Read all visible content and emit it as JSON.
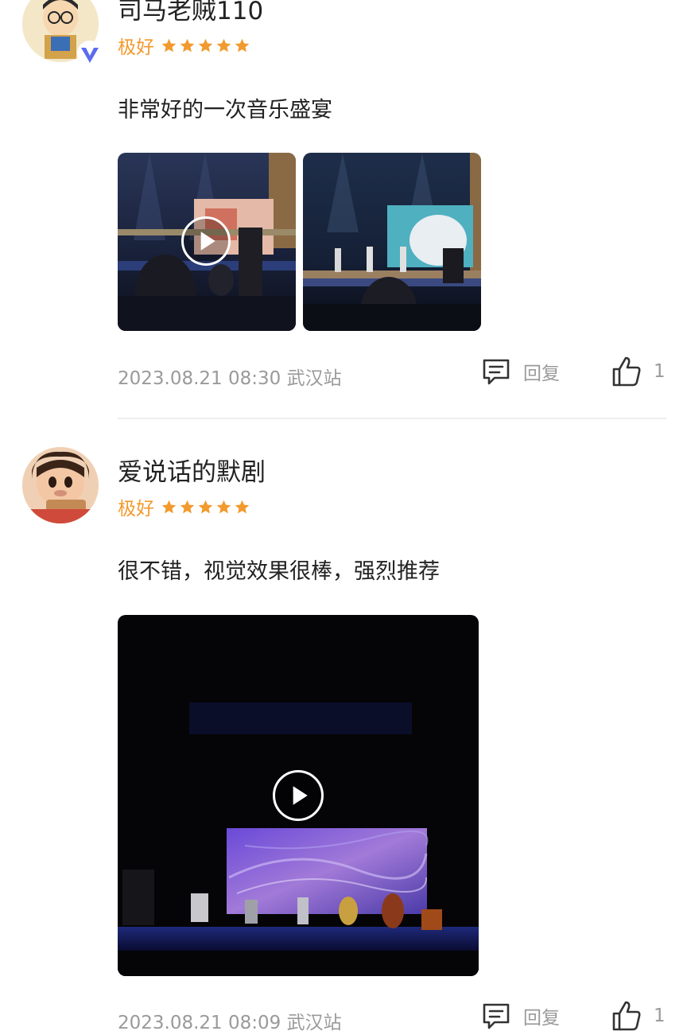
{
  "reviews": [
    {
      "username": "司马老贼110",
      "rating_text": "极好",
      "stars": 5,
      "comment": "非常好的一次音乐盛宴",
      "date_location": "2023.08.21 08:30 武汉站",
      "reply_label": "回复",
      "like_count": "1",
      "verified_badge": "vip-v-icon",
      "media": [
        {
          "type": "video",
          "icon": "play-icon"
        },
        {
          "type": "image"
        }
      ]
    },
    {
      "username": "爱说话的默剧",
      "rating_text": "极好",
      "stars": 5,
      "comment": "很不错，视觉效果很棒，强烈推荐",
      "date_location": "2023.08.21 08:09 武汉站",
      "reply_label": "回复",
      "like_count": "1",
      "media": [
        {
          "type": "video",
          "icon": "play-icon"
        }
      ]
    }
  ],
  "colors": {
    "rating": "#f29a2e",
    "meta": "#9a9a9a",
    "text": "#222222",
    "vip_badge": "#5b6cf0"
  }
}
